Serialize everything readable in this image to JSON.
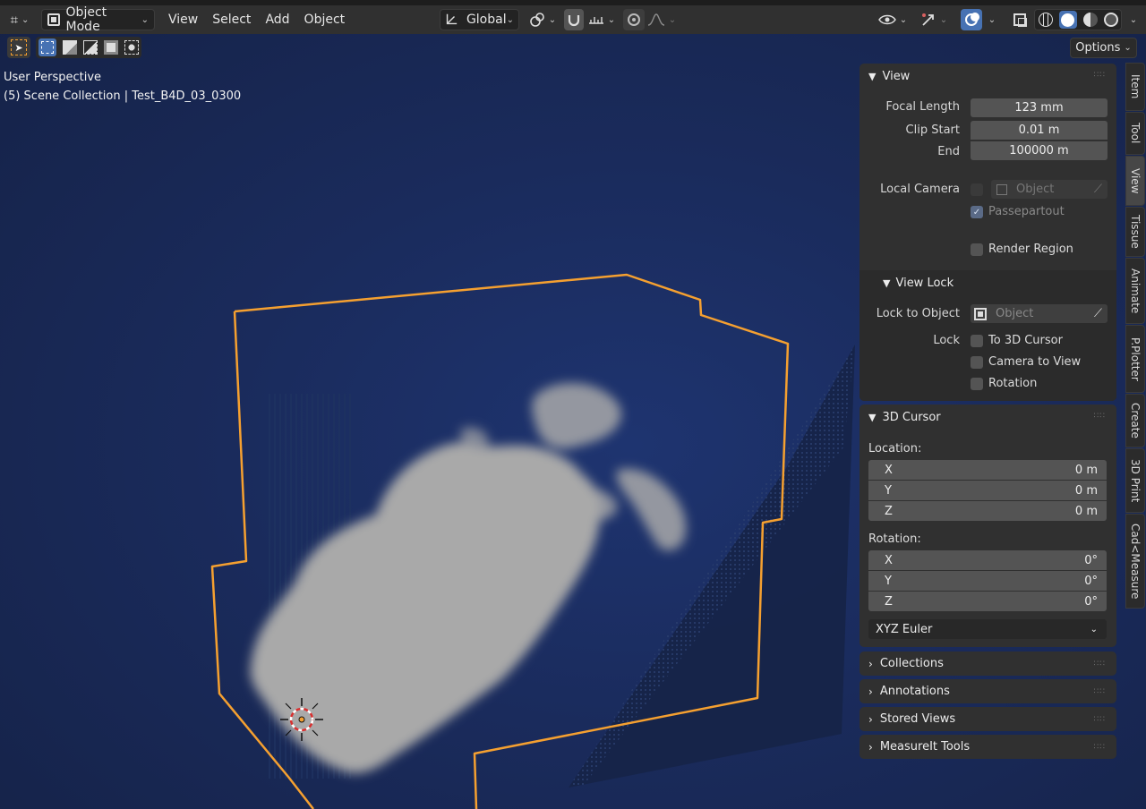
{
  "header": {
    "mode_label": "Object Mode",
    "menus": [
      "View",
      "Select",
      "Add",
      "Object"
    ],
    "transform_orientation": "Global",
    "options_label": "Options"
  },
  "viewport": {
    "perspective_label": "User Perspective",
    "collection_label": "(5) Scene Collection | Test_B4D_03_0300",
    "background_color": "#1a2b5c",
    "bounds_color": "#f5a030",
    "smoke_color": "#a9a9a9"
  },
  "side_tabs": [
    "Item",
    "Tool",
    "View",
    "Tissue",
    "Animate",
    "P.Plotter",
    "Create",
    "3D Print",
    "Cad<Measure"
  ],
  "active_tab": "View",
  "view_panel": {
    "title": "View",
    "focal_length_label": "Focal Length",
    "focal_length": "123 mm",
    "clip_start_label": "Clip Start",
    "clip_start": "0.01 m",
    "clip_end_label": "End",
    "clip_end": "100000 m",
    "local_camera_label": "Local Camera",
    "local_camera_placeholder": "Object",
    "passepartout_label": "Passepartout",
    "render_region_label": "Render Region",
    "view_lock_title": "View Lock",
    "lock_to_object_label": "Lock to Object",
    "lock_to_object_placeholder": "Object",
    "lock_label": "Lock",
    "to_3d_cursor_label": "To 3D Cursor",
    "camera_to_view_label": "Camera to View",
    "rotation_label": "Rotation"
  },
  "cursor_panel": {
    "title": "3D Cursor",
    "location_label": "Location:",
    "location": [
      {
        "axis": "X",
        "value": "0 m"
      },
      {
        "axis": "Y",
        "value": "0 m"
      },
      {
        "axis": "Z",
        "value": "0 m"
      }
    ],
    "rotation_label": "Rotation:",
    "rotation": [
      {
        "axis": "X",
        "value": "0°"
      },
      {
        "axis": "Y",
        "value": "0°"
      },
      {
        "axis": "Z",
        "value": "0°"
      }
    ],
    "rotation_mode": "XYZ Euler"
  },
  "collapsed_panels": [
    "Collections",
    "Annotations",
    "Stored Views",
    "MeasureIt Tools"
  ]
}
